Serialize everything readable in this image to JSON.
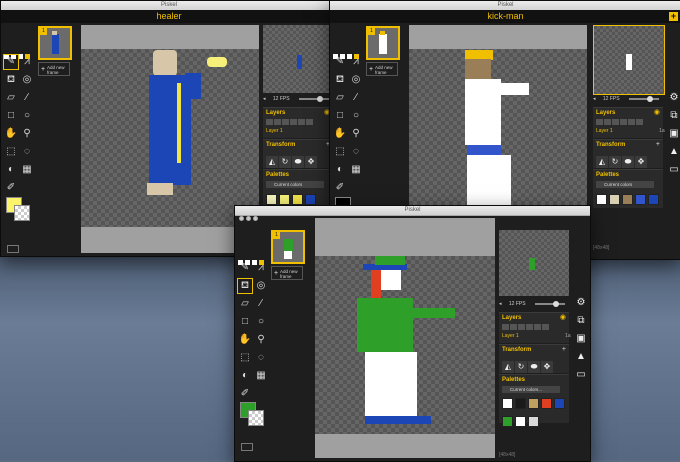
{
  "windows": {
    "healer": {
      "title": "Piskel",
      "name": "healer",
      "fps": "12 FPS",
      "new_frame": "Add new frame",
      "frame_index": "1"
    },
    "kickman": {
      "title": "Piskel",
      "name": "kick-man",
      "fps": "12 FPS",
      "new_frame": "Add new frame",
      "frame_index": "1",
      "dims": "[48x48]"
    },
    "third": {
      "title": "Piskel",
      "fps": "12 FPS",
      "new_frame": "Add new frame",
      "frame_index": "1",
      "dims": "[48x48]"
    }
  },
  "panels": {
    "layers_title": "Layers",
    "layer_name": "Layer 1",
    "layer_opacity": "1a",
    "transform_title": "Transform",
    "palettes_title": "Palettes",
    "palette_name": "Current colors",
    "palette_name_short": "Current colors..."
  },
  "colors": {
    "accent": "#f0c000",
    "healer_primary": "#fbf36a",
    "kickman_primary": "#000000",
    "third_primary": "#2ea02a"
  },
  "palettes": {
    "healer": [
      "#f6f5bd",
      "#f6f07a",
      "#f1e246",
      "#1c45b5"
    ],
    "kickman": [
      "#ffffff",
      "#d9d0b4",
      "#9a7e58",
      "#3355cc",
      "#1c45b5"
    ],
    "third": [
      "#ffffff",
      "#1a1a1a",
      "#c0a060",
      "#e04020",
      "#1c45b5",
      "#2ea02a",
      "#ffffff",
      "#d9d9d9"
    ]
  },
  "icons": [
    "pen-icon",
    "vertical-mirror-pen-icon",
    "paint-bucket-icon",
    "magic-bucket-icon",
    "eraser-icon",
    "stroke-icon",
    "rectangle-icon",
    "circle-icon",
    "move-icon",
    "shape-select-icon",
    "rect-select-icon",
    "lasso-select-icon",
    "lighten-icon",
    "dithering-icon",
    "color-picker-icon",
    "gear-icon",
    "resize-icon",
    "save-icon",
    "image-export-icon",
    "folder-icon"
  ]
}
